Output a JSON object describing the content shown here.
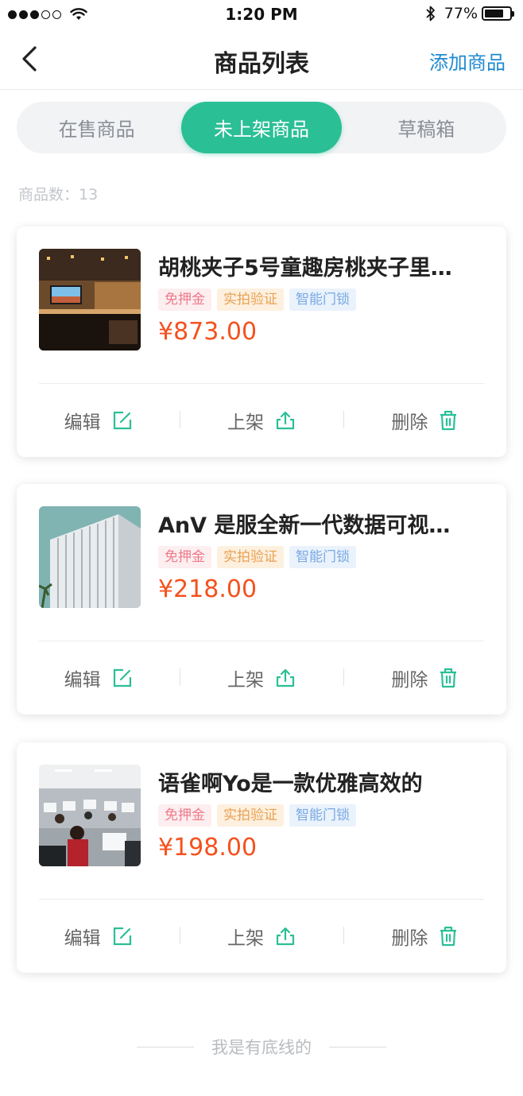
{
  "status_bar": {
    "time": "1:20 PM",
    "battery": "77%",
    "battery_level": 0.77
  },
  "nav": {
    "title": "商品列表",
    "action": "添加商品",
    "back_icon": "chevron-left-icon"
  },
  "tabs": [
    {
      "label": "在售商品",
      "active": false
    },
    {
      "label": "未上架商品",
      "active": true
    },
    {
      "label": "草稿箱",
      "active": false
    }
  ],
  "count": {
    "label": "商品数：",
    "value": "13"
  },
  "products": [
    {
      "title": "胡桃夹子5号童趣房桃夹子里…",
      "tags": [
        "免押金",
        "实拍验证",
        "智能门锁"
      ],
      "price": "¥873.00",
      "image": "living-room-photo",
      "actions": {
        "edit": "编辑",
        "shelve": "上架",
        "delete": "删除"
      }
    },
    {
      "title": "AnV  是服全新一代数据可视…",
      "tags": [
        "免押金",
        "实拍验证",
        "智能门锁"
      ],
      "price": "¥218.00",
      "image": "office-building-photo",
      "actions": {
        "edit": "编辑",
        "shelve": "上架",
        "delete": "删除"
      }
    },
    {
      "title": "语雀啊Yo是一款优雅高效的",
      "tags": [
        "免押金",
        "实拍验证",
        "智能门锁"
      ],
      "price": "¥198.00",
      "image": "computer-lab-photo",
      "actions": {
        "edit": "编辑",
        "shelve": "上架",
        "delete": "删除"
      }
    }
  ],
  "footer": {
    "text": "我是有底线的"
  },
  "colors": {
    "accent": "#2bbf96",
    "link": "#1f8ad1",
    "price": "#f4511e"
  }
}
